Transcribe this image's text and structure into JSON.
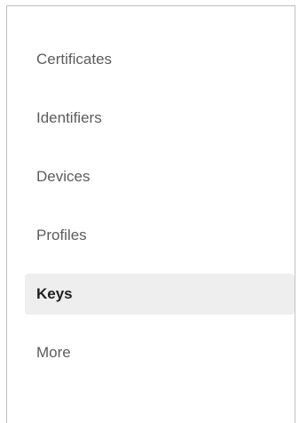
{
  "sidebar": {
    "active_item": "Keys",
    "items": [
      {
        "label": "Certificates"
      },
      {
        "label": "Identifiers"
      },
      {
        "label": "Devices"
      },
      {
        "label": "Profiles"
      },
      {
        "label": "Keys"
      },
      {
        "label": "More"
      }
    ]
  },
  "colors": {
    "text": "#5c5c5c",
    "active_text": "#1f1f1f",
    "active_background": "#eeeeee",
    "border": "#bfbfbf"
  }
}
